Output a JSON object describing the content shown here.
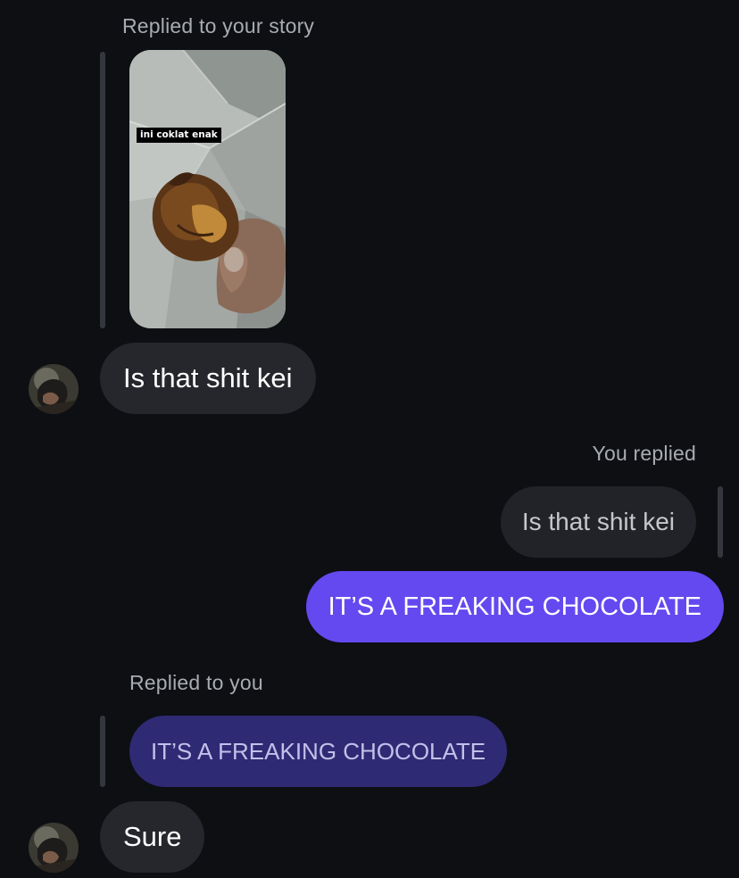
{
  "conversation": {
    "story_reply": {
      "label": "Replied to your story",
      "story_caption": "ini coklat enak",
      "message": "Is that shit kei"
    },
    "my_reply": {
      "label": "You replied",
      "quoted": "Is that shit kei",
      "message": "IT’S A FREAKING CHOCOLATE"
    },
    "their_reply": {
      "label": "Replied to you",
      "quoted": "IT’S A FREAKING CHOCOLATE",
      "message": "Sure"
    }
  },
  "colors": {
    "background": "#0d0f13",
    "incoming_bubble": "#25272c",
    "outgoing_bubble": "#6449f0",
    "quoted_outgoing_bubble": "#2f2a74"
  }
}
